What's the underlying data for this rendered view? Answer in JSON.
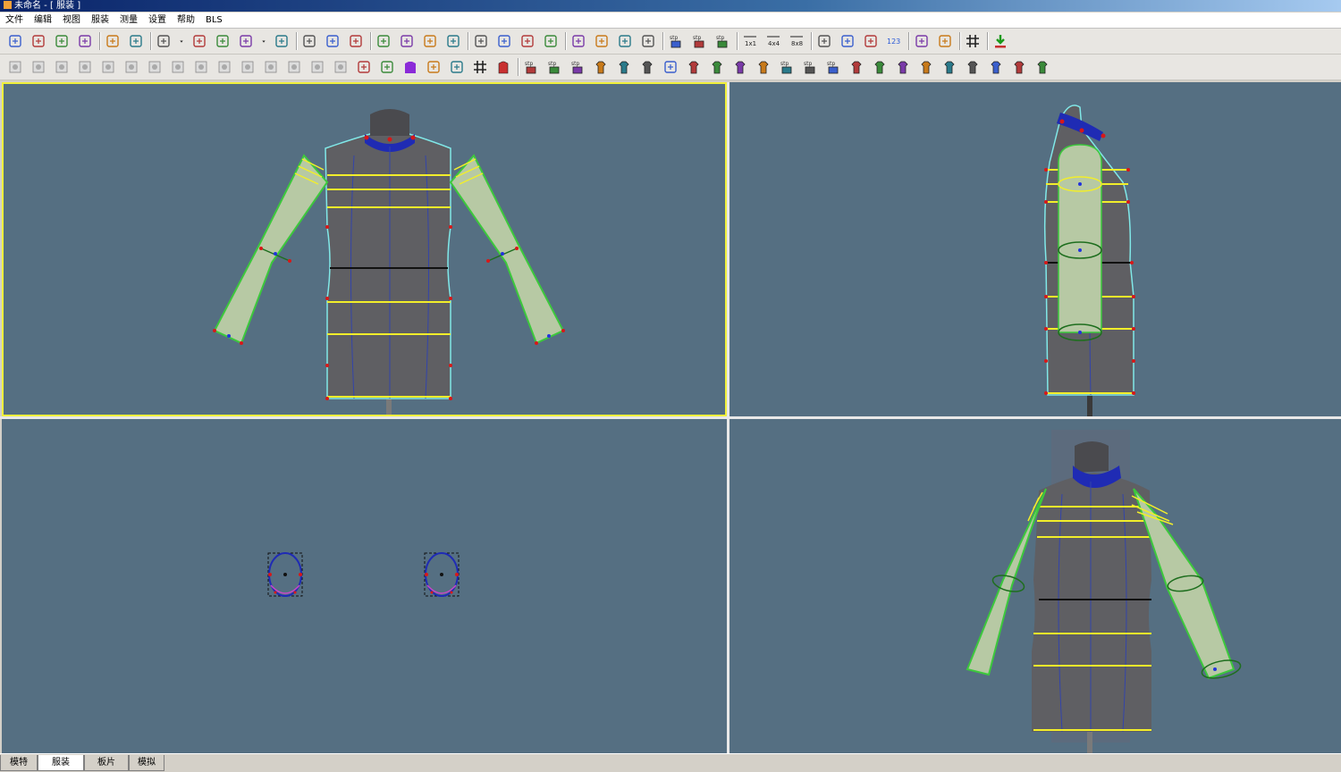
{
  "window": {
    "title": "未命名 - [ 服装 ]"
  },
  "menu": [
    "文件",
    "编辑",
    "视图",
    "服装",
    "测量",
    "设置",
    "帮助",
    "BLS"
  ],
  "toolbar1": {
    "icons": [
      "new-icon",
      "open-icon",
      "save-icon",
      "save-as-icon",
      "undo-icon",
      "redo-icon",
      "import-icon",
      "dropdown-icon",
      "frame-icon",
      "model-grid-icon",
      "render-icon",
      "dropdown-icon",
      "flag-icon",
      "shirt-icon",
      "scissors-icon",
      "model-icon",
      "rotate-icon",
      "pan-icon",
      "zoom-icon",
      "orbit-icon",
      "align-left-icon",
      "align-center-icon",
      "align-right-icon",
      "ruler-icon",
      "curve-icon",
      "curve-mirror-icon",
      "grid-select-icon",
      "arrow-icon",
      "stp-load-icon",
      "stp-save-icon",
      "stp-export-icon",
      "scale-1x1-icon",
      "scale-4x4-icon",
      "scale-8x8-icon",
      "bucket-icon",
      "pentagon-icon",
      "house-icon",
      "numbering-icon",
      "body-outline-icon",
      "body-figure-icon",
      "grid-icon",
      "download-icon"
    ],
    "labels": {
      "scale1": "1x1",
      "scale4": "4x4",
      "scale8": "8x8",
      "numbering": "123"
    }
  },
  "toolbar2": {
    "icons": [
      "tool-01-icon",
      "tool-02-icon",
      "tool-03-icon",
      "tool-04-icon",
      "tool-05-icon",
      "tool-06-icon",
      "tool-07-icon",
      "tool-08-icon",
      "tool-09-icon",
      "tool-10-icon",
      "tool-11-icon",
      "tool-12-icon",
      "tool-13-icon",
      "tool-14-icon",
      "tool-15-icon",
      "dress-form-icon",
      "pentagon-body-icon",
      "purple-garment-icon",
      "collar-ring-icon",
      "neckline-icon",
      "grid-hash-icon",
      "red-garment-icon",
      "stp-1-icon",
      "stp-2-icon",
      "stp-3-icon",
      "garment-a-icon",
      "garment-b-icon",
      "garment-c-icon",
      "arch-icon",
      "garment-d-icon",
      "garment-e-icon",
      "garment-f-icon",
      "garment-g-icon",
      "stp-4-icon",
      "stp-5-icon",
      "stp-6-icon",
      "garment-h-icon",
      "garment-i-icon",
      "garment-j-icon",
      "garment-k-icon",
      "garment-l-icon",
      "garment-m-icon",
      "garment-n-icon",
      "garment-o-icon",
      "garment-p-icon"
    ]
  },
  "tabs": [
    "模特",
    "服装",
    "板片",
    "模拟"
  ],
  "active_tab": 1,
  "colors": {
    "viewport": "#556f82",
    "active_border": "#f0f03c",
    "sleeve": "#b7c9a4",
    "body": "#5f5f63",
    "collar": "#1f2bb4",
    "measure_line": "#f2ee2a",
    "waist_line": "#111111",
    "edge": "#80e8e8",
    "point": "#d81818"
  }
}
